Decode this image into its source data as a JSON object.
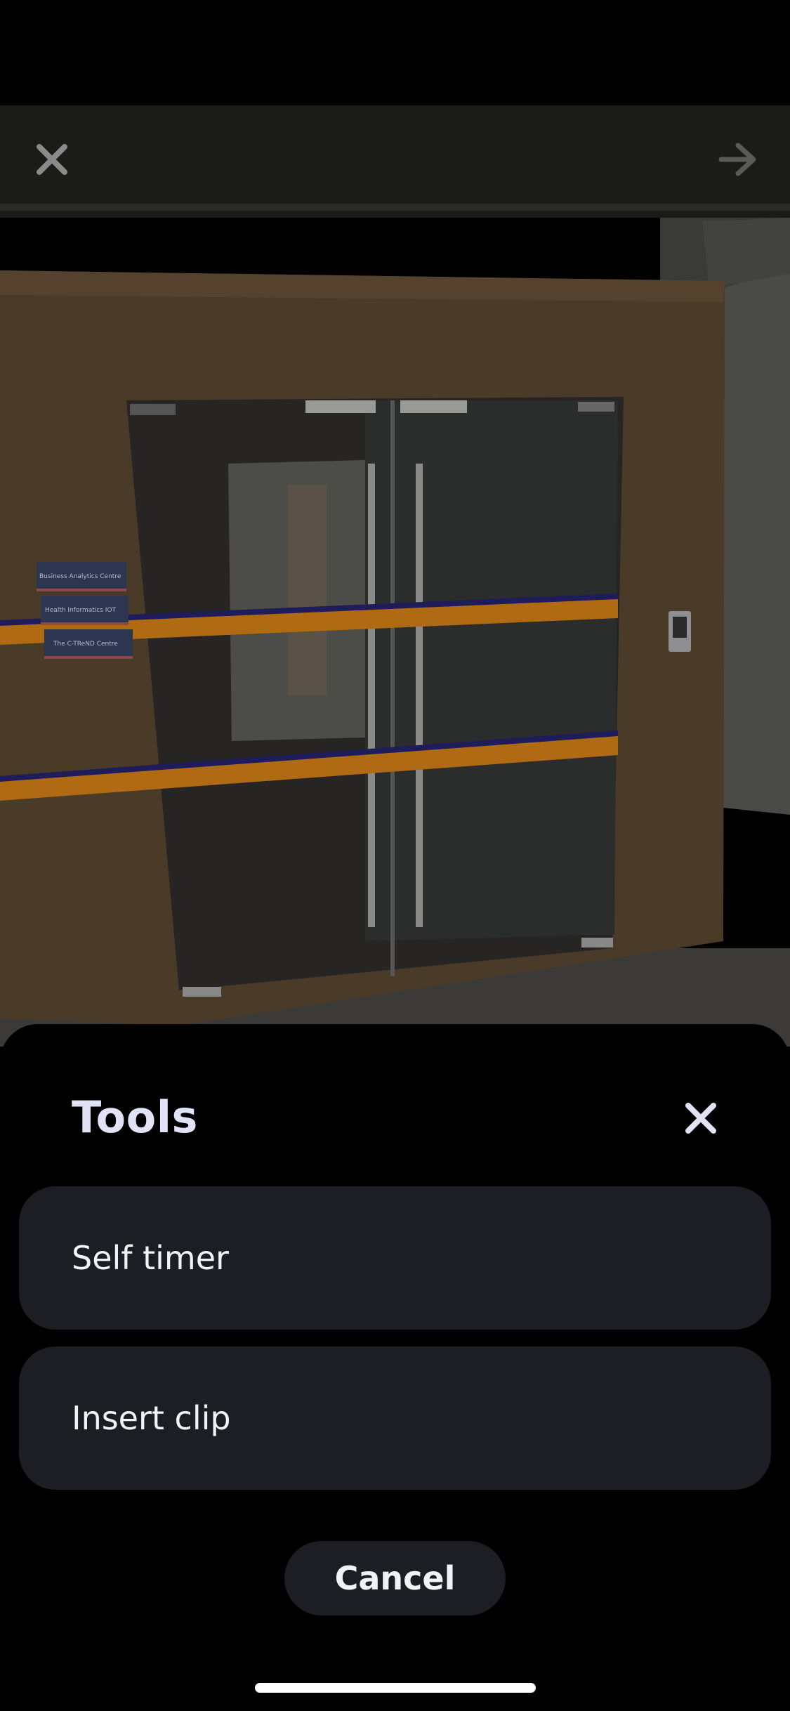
{
  "camera": {
    "close_icon": "close-icon",
    "next_icon": "arrow-right-icon",
    "scene": {
      "sign_lines": [
        "Business Analytics Centre",
        "Health Informatics IOT",
        "The C-TReND Centre"
      ]
    }
  },
  "tools_sheet": {
    "title": "Tools",
    "close_icon": "close-icon",
    "options": [
      {
        "label": "Self timer"
      },
      {
        "label": "Insert clip"
      }
    ],
    "cancel_label": "Cancel"
  },
  "colors": {
    "sheet_background": "#000000",
    "option_background": "#1c1e24",
    "title_color": "#dfe3f5",
    "text_color": "#f2f3f7"
  }
}
